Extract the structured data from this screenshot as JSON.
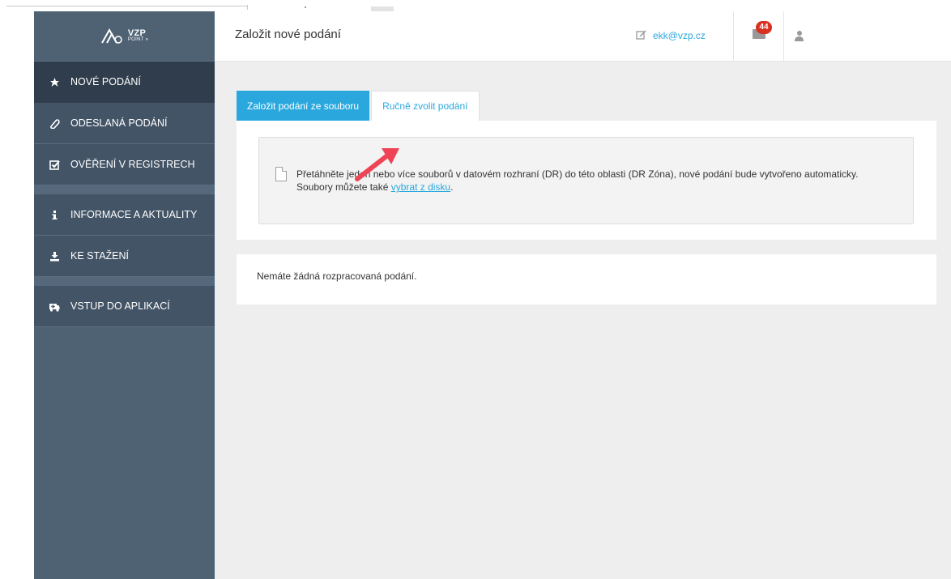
{
  "header": {
    "page_title": "Založit nové podání",
    "user_email": "ekk@vzp.cz",
    "mail_count": "44",
    "logo_text": "VZP",
    "logo_subtext": "POINT"
  },
  "sidebar": {
    "items": [
      {
        "label": "NOVÉ PODÁNÍ",
        "icon": "leaf-icon"
      },
      {
        "label": "ODESLANÁ PODÁNÍ",
        "icon": "paperclip-icon"
      },
      {
        "label": "OVĚŘENÍ V REGISTRECH",
        "icon": "checkbox-icon"
      },
      {
        "label": "INFORMACE A AKTUALITY",
        "icon": "info-icon"
      },
      {
        "label": "KE STAŽENÍ",
        "icon": "download-icon"
      },
      {
        "label": "VSTUP DO APLIKACÍ",
        "icon": "ambulance-icon"
      }
    ]
  },
  "tabs": [
    {
      "label": "Založit podání ze souboru"
    },
    {
      "label": "Ručně zvolit podání"
    }
  ],
  "dropzone": {
    "line1": "Přetáhněte jeden nebo více souborů v datovém rozhraní (DR) do této oblasti (DR Zóna), nové podání bude vytvořeno automaticky.",
    "line2_prefix": "Soubory můžete také ",
    "line2_link": "vybrat z disku",
    "line2_suffix": "."
  },
  "drafts": {
    "empty_message": "Nemáte žádná rozpracovaná podání."
  },
  "colors": {
    "accent": "#2aa8de",
    "sidebar": "#4f6274",
    "sidebar_active": "#2f3d4c",
    "badge": "#d9301f",
    "arrow": "#ee4455"
  }
}
